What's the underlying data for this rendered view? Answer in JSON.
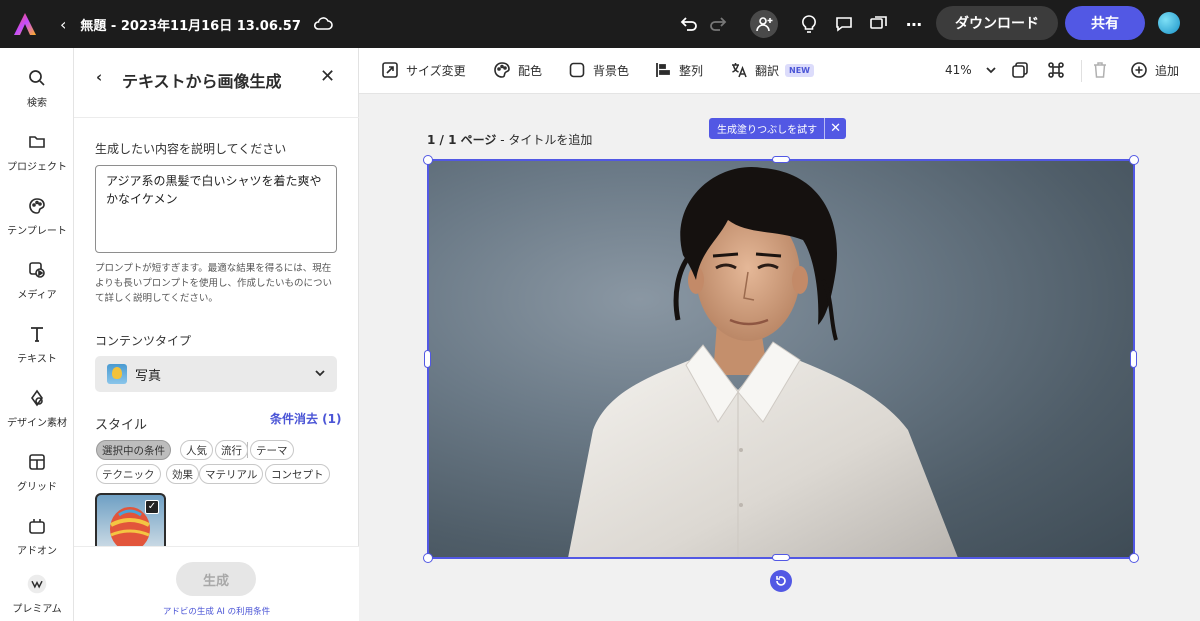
{
  "topbar": {
    "doc_title": "無題 - 2023年11月16日 13.06.57",
    "download_label": "ダウンロード",
    "share_label": "共有"
  },
  "rail": {
    "items": [
      {
        "label": "検索",
        "icon": "search-icon"
      },
      {
        "label": "プロジェクト",
        "icon": "folder-icon"
      },
      {
        "label": "テンプレート",
        "icon": "template-icon"
      },
      {
        "label": "メディア",
        "icon": "media-icon"
      },
      {
        "label": "テキスト",
        "icon": "text-icon"
      },
      {
        "label": "デザイン素材",
        "icon": "shapes-icon"
      },
      {
        "label": "グリッド",
        "icon": "grid-icon"
      },
      {
        "label": "アドオン",
        "icon": "addon-icon"
      },
      {
        "label": "プレミアム",
        "icon": "premium-icon"
      }
    ]
  },
  "panel": {
    "title": "テキストから画像生成",
    "describe_label": "生成したい内容を説明してください",
    "prompt_value": "アジア系の黒髪で白いシャツを着た爽やかなイケメン",
    "hint": "プロンプトが短すぎます。最適な結果を得るには、現在よりも長いプロンプトを使用し、作成したいものについて詳しく説明してください。",
    "content_type_label": "コンテンツタイプ",
    "content_type_value": "写真",
    "style_label": "スタイル",
    "clear_label": "条件消去 (1)",
    "chips_row1": [
      "選択中の条件",
      "人気",
      "流行",
      "テーマ"
    ],
    "chips_row2": [
      "テクニック",
      "効果",
      "マテリアル",
      "コンセプト"
    ],
    "generate_label": "生成",
    "terms_label": "アドビの生成 AI の利用条件"
  },
  "toolbar": {
    "resize": "サイズ変更",
    "color": "配色",
    "background": "背景色",
    "align": "整列",
    "translate": "翻訳",
    "new_badge": "NEW",
    "zoom": "41%",
    "add": "追加"
  },
  "canvas": {
    "page_number": "1 / 1 ページ",
    "page_title": " - タイトルを追加",
    "gen_fill_label": "生成塗りつぶしを試す"
  },
  "colors": {
    "accent": "#5258e4",
    "topbar": "#1c1c1c"
  }
}
